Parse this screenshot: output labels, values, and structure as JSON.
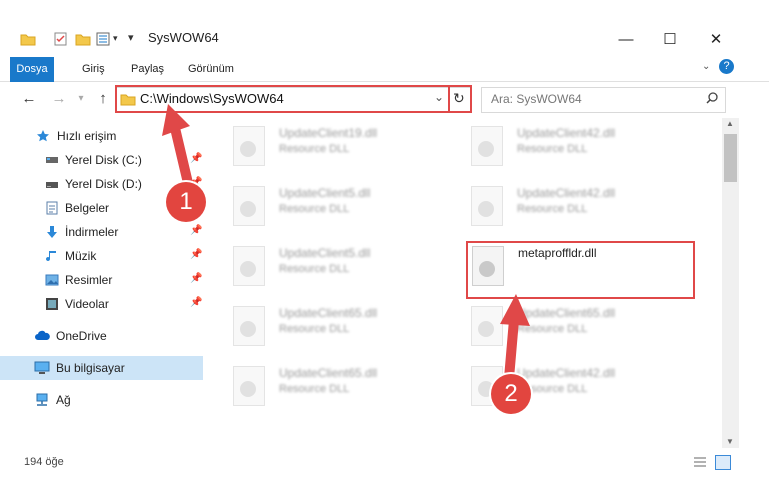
{
  "window": {
    "title": "SysWOW64",
    "controls": [
      "—",
      "☐",
      "✕"
    ]
  },
  "ribbon": {
    "tabs": [
      "Dosya",
      "Giriş",
      "Paylaş",
      "Görünüm"
    ]
  },
  "nav": {
    "address": "C:\\Windows\\SysWOW64",
    "search_placeholder": "Ara: SysWOW64"
  },
  "sidebar": {
    "items": [
      {
        "label": "Hızlı erişim",
        "icon": "star-icon"
      },
      {
        "label": "Yerel Disk (C:)",
        "icon": "drive-icon"
      },
      {
        "label": "Yerel Disk (D:)",
        "icon": "drive-icon"
      },
      {
        "label": "Belgeler",
        "icon": "documents-icon"
      },
      {
        "label": "İndirmeler",
        "icon": "download-icon"
      },
      {
        "label": "Müzik",
        "icon": "music-icon"
      },
      {
        "label": "Resimler",
        "icon": "pictures-icon"
      },
      {
        "label": "Videolar",
        "icon": "videos-icon"
      },
      {
        "label": "OneDrive",
        "icon": "cloud-icon"
      },
      {
        "label": "Bu bilgisayar",
        "icon": "computer-icon"
      },
      {
        "label": "Ağ",
        "icon": "network-icon"
      }
    ]
  },
  "files": [
    {
      "name": "UpdateClient19.dll",
      "desc": "Resource DLL"
    },
    {
      "name": "UpdateClient42.dll",
      "desc": "Resource DLL"
    },
    {
      "name": "UpdateClient5.dll",
      "desc": "Resource DLL"
    },
    {
      "name": "UpdateClient42.dll",
      "desc": "Resource DLL"
    },
    {
      "name": "UpdateClient5.dll",
      "desc": "Resource DLL"
    },
    {
      "name": "metaproffldr.dll",
      "desc": ""
    },
    {
      "name": "UpdateClient65.dll",
      "desc": "Resource DLL"
    },
    {
      "name": "UpdateClient65.dll",
      "desc": "Resource DLL"
    },
    {
      "name": "UpdateClient65.dll",
      "desc": "Resource DLL"
    },
    {
      "name": "UpdateClient42.dll",
      "desc": "Resource DLL"
    }
  ],
  "status": {
    "count": "194 öğe"
  },
  "annotations": {
    "step1": "1",
    "step2": "2"
  },
  "colors": {
    "accent": "#1979ca",
    "annotation": "#e04848",
    "selection": "#cce4f7"
  }
}
